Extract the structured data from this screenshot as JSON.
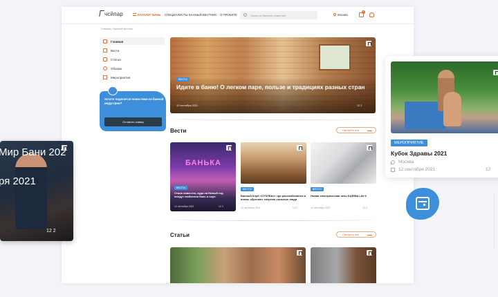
{
  "header": {
    "logo": "чсйпар",
    "nav": [
      "КАТАЛОГ БАНЬ",
      "СПЕЦИАЛИСТЫ",
      "БАННЫЙ ВЕСТНИК",
      "О ПРОЕКТЕ"
    ],
    "search_placeholder": "Поиск по банным новостям",
    "location": "Москва",
    "cart_count": "0"
  },
  "breadcrumbs": "Главная / Банный вестник",
  "sidebar": {
    "items": [
      "Главная",
      "Вести",
      "Статьи",
      "Обзоры",
      "Мероприятия"
    ],
    "promo_text": "Хотите поделится новостями из банной индустрии?",
    "promo_button": "Оставить заявку"
  },
  "hero": {
    "tag": "ВЕСТИ",
    "title": "Идите в баню! О легком паре, пользе и традициях разных стран",
    "date": "12 сентября 2021",
    "stats": "12  2"
  },
  "news": {
    "heading": "Вести",
    "see_all": "Смотреть все",
    "cards": [
      {
        "sign": "БАНЬКА",
        "tag": "ВЕСТИ",
        "title": "Стало известно, куда на Новый год поедут любители бань и саун",
        "date": "12 сентября 2021",
        "stats": "12  2"
      },
      {
        "tag": "ВЕСТИ",
        "title": "Банный Клуб «СТОЛБЫ»: где расслабляются и вновь обретают энергию сильные люди",
        "date": "12 сентября 2021",
        "stats": "12  2"
      },
      {
        "tag": "ВЕСТИ",
        "title": "Новая электрическая печь KARINA Lite 6",
        "date": "12 сентября 2021",
        "stats": "12  2"
      }
    ]
  },
  "articles": {
    "heading": "Статьи",
    "see_all": "Смотреть все"
  },
  "left_card": {
    "text_top": "Мир Бани 202",
    "text_bottom": "ря 2021",
    "stats": "12  2"
  },
  "right_card": {
    "tag": "МЕРОПРИЯТИЕ",
    "title": "Кубок Здравы 2021",
    "city": "Москва",
    "date": "12 сентября 2021",
    "stats": "12"
  },
  "colors": {
    "accent": "#e46a27",
    "blue": "#3d8fdb",
    "dark": "#2a3b4a"
  }
}
